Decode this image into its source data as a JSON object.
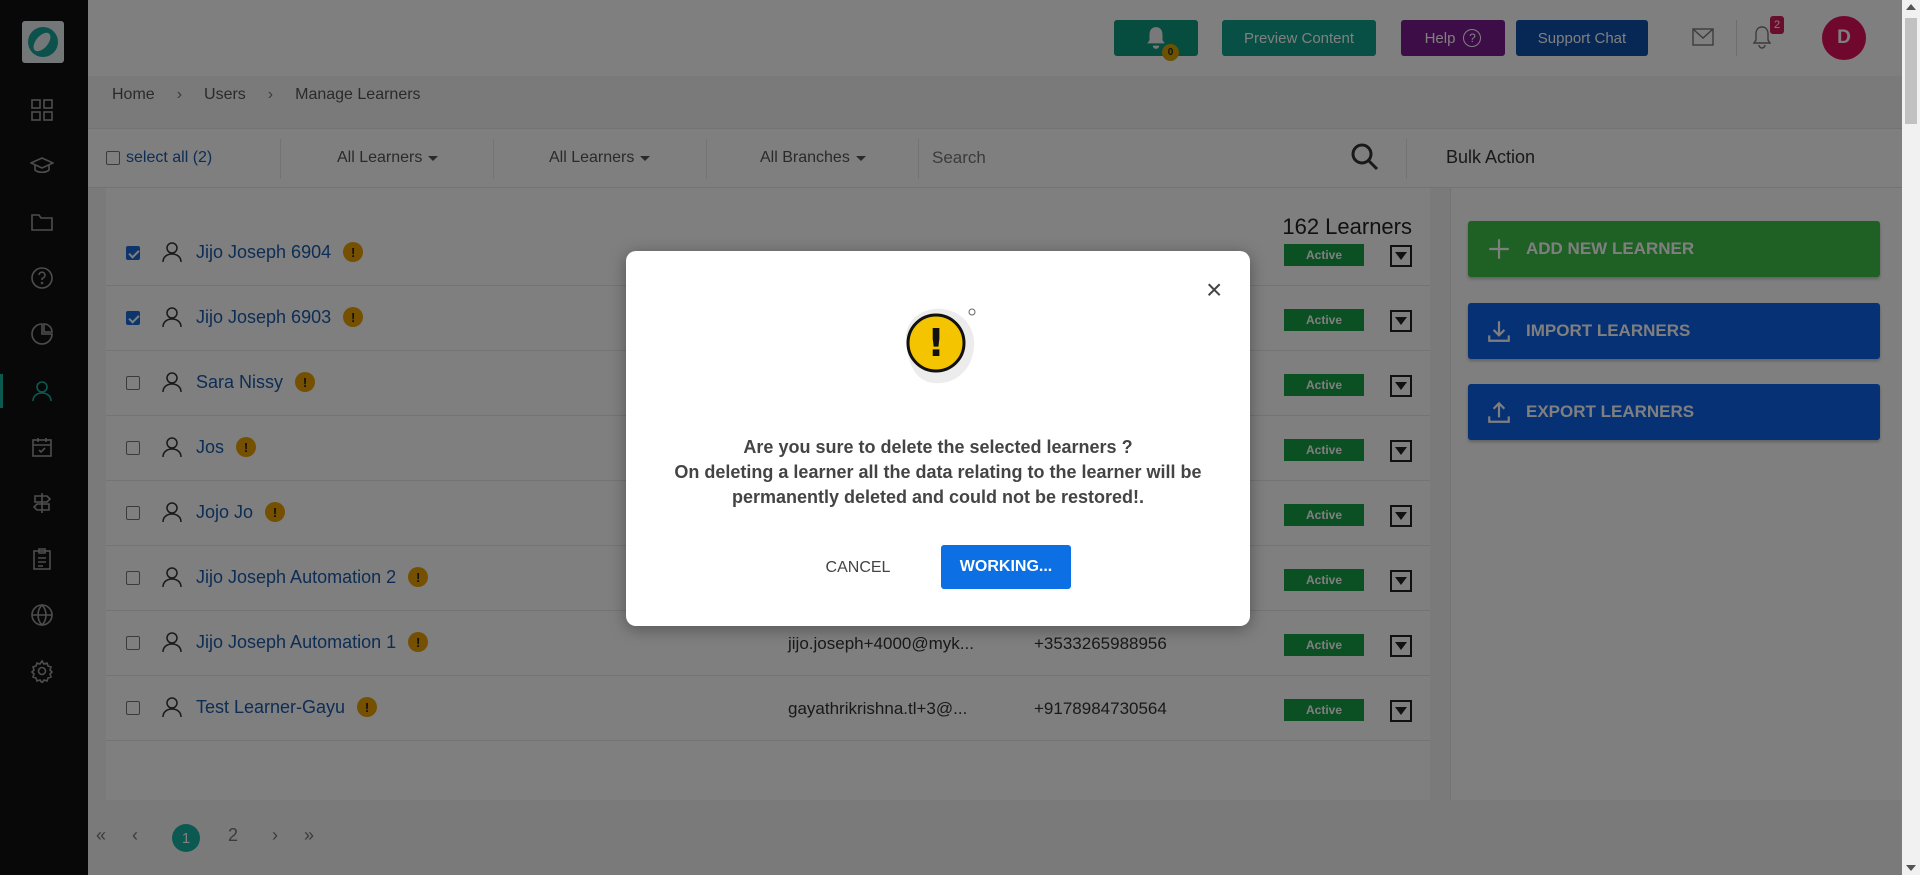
{
  "topbar": {
    "bell_count": "0",
    "preview_label": "Preview Content",
    "help_label": "Help",
    "help_glyph": "?",
    "support_label": "Support Chat",
    "notif_count": "2",
    "avatar_letter": "D"
  },
  "breadcrumb": [
    "Home",
    "Users",
    "Manage Learners"
  ],
  "filters": {
    "select_all": "select all (2)",
    "filter1": "All Learners",
    "filter2": "All Learners",
    "filter3": "All Branches",
    "search_placeholder": "Search",
    "bulk_action": "Bulk Action"
  },
  "list": {
    "count": "162 Learners",
    "rows": [
      {
        "name": "Jijo Joseph 6904",
        "email": "",
        "phone": "",
        "status": "Active",
        "checked": true
      },
      {
        "name": "Jijo Joseph 6903",
        "email": "",
        "phone": "",
        "status": "Active",
        "checked": true
      },
      {
        "name": "Sara Nissy",
        "email": "",
        "phone": "",
        "status": "Active",
        "checked": false
      },
      {
        "name": "Jos",
        "email": "",
        "phone": "",
        "status": "Active",
        "checked": false
      },
      {
        "name": "Jojo Jo",
        "email": "",
        "phone": "",
        "status": "Active",
        "checked": false
      },
      {
        "name": "Jijo Joseph Automation 2",
        "email": "",
        "phone": "",
        "status": "Active",
        "checked": false
      },
      {
        "name": "Jijo Joseph Automation 1",
        "email": "jijo.joseph+4000@myk...",
        "phone": "+3533265988956",
        "status": "Active",
        "checked": false
      },
      {
        "name": "Test Learner-Gayu",
        "email": "gayathrikrishna.tl+3@...",
        "phone": "+9178984730564",
        "status": "Active",
        "checked": false
      }
    ],
    "warn_glyph": "!"
  },
  "actions": {
    "add": "ADD NEW LEARNER",
    "import": "IMPORT LEARNERS",
    "export": "EXPORT LEARNERS"
  },
  "pager": {
    "first": "«",
    "prev": "‹",
    "page1": "1",
    "page2": "2",
    "next": "›",
    "last": "»"
  },
  "modal": {
    "close": "×",
    "line1": "Are you sure to delete the selected learners ?",
    "line2": "On deleting a learner all the data relating to the learner will be",
    "line3": "permanently deleted and could not be restored!.",
    "cancel": "CANCEL",
    "confirm": "WORKING...",
    "warning_glyph": "!"
  },
  "colors": {
    "brand_teal": "#11a18a",
    "help_purple": "#7a1a8e",
    "support_blue": "#0f4fa8",
    "action_green": "#3ec34a",
    "action_blue": "#0d63e8",
    "active_green": "#17a047",
    "warning_yellow": "#f5c400"
  }
}
